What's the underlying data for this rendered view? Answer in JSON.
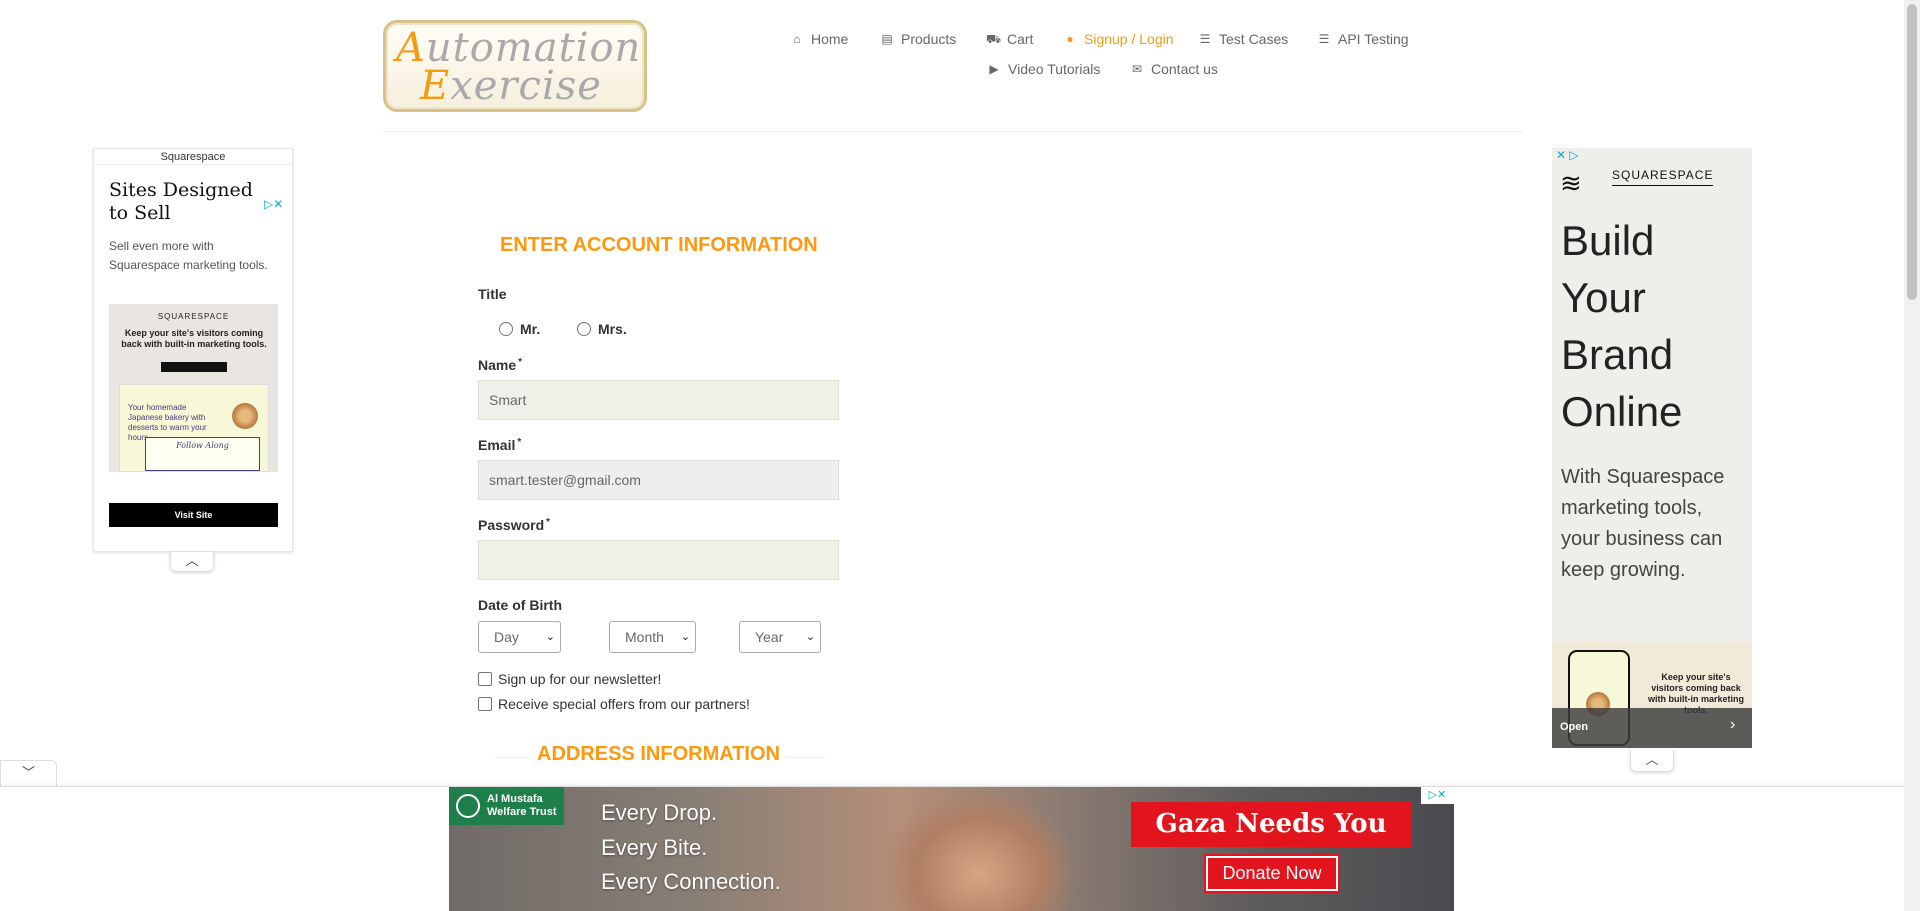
{
  "header": {
    "logo": {
      "line1_cap": "A",
      "line1_rest": "utomation",
      "line2_cap": "E",
      "line2_rest": "xercise"
    },
    "nav": [
      {
        "label": "Home",
        "icon": "home-icon",
        "glyph": "⌂"
      },
      {
        "label": "Products",
        "icon": "products-icon",
        "glyph": "▤"
      },
      {
        "label": "Cart",
        "icon": "cart-icon",
        "glyph": "⛟"
      },
      {
        "label": "Signup / Login",
        "icon": "lock-icon",
        "glyph": "🔒",
        "active": true
      },
      {
        "label": "Test Cases",
        "icon": "list-icon",
        "glyph": "☰"
      },
      {
        "label": "API Testing",
        "icon": "list-icon",
        "glyph": "☰"
      },
      {
        "label": "Video Tutorials",
        "icon": "youtube-icon",
        "glyph": "▶"
      },
      {
        "label": "Contact us",
        "icon": "envelope-icon",
        "glyph": "✉"
      }
    ],
    "active_color": "#f39c12"
  },
  "left_ad": {
    "brand": "Squarespace",
    "title": "Sites Designed to Sell",
    "text": "Sell even more with Squarespace marketing tools.",
    "image_brand": "SQUARESPACE",
    "image_headline": "Keep your site's visitors coming back with built-in marketing tools.",
    "image_card_text": "Your homemade Japanese bakery with desserts to warm your hours.",
    "image_follow": "Follow Along",
    "button": "Visit Site",
    "adchoices": "▷✕",
    "collapse": "︿"
  },
  "right_ad": {
    "adchoices": "✕ ▷",
    "brand": "SQUARESPACE",
    "headline": "Build Your Brand Online",
    "text": "With Squarespace marketing tools, your business can keep growing.",
    "image_text": "Keep your site's visitors coming back with built-in marketing tools.",
    "open": "Open",
    "arrow": "›",
    "collapse": "︿"
  },
  "form": {
    "account_title": "ENTER ACCOUNT INFORMATION",
    "title_label": "Title",
    "radio_mr": "Mr.",
    "radio_mrs": "Mrs.",
    "name_label": "Name",
    "name_value": "Smart",
    "email_label": "Email",
    "email_value": "smart.tester@gmail.com",
    "password_label": "Password",
    "password_value": "",
    "required_mark": "*",
    "dob_label": "Date of Birth",
    "day": "Day",
    "month": "Month",
    "year": "Year",
    "newsletter": "Sign up for our newsletter!",
    "offers": "Receive special offers from our partners!",
    "address_title": "ADDRESS INFORMATION",
    "accent_color": "#fe980f"
  },
  "bottom_ad": {
    "org": "Al Mustafa Welfare Trust",
    "line1": "Every Drop.",
    "line2": "Every Bite.",
    "line3": "Every Connection.",
    "headline": "Gaza Needs You",
    "donate": "Donate Now",
    "adchoices": "▷✕",
    "collapse": "﹀",
    "accent_color": "#e2141d"
  }
}
